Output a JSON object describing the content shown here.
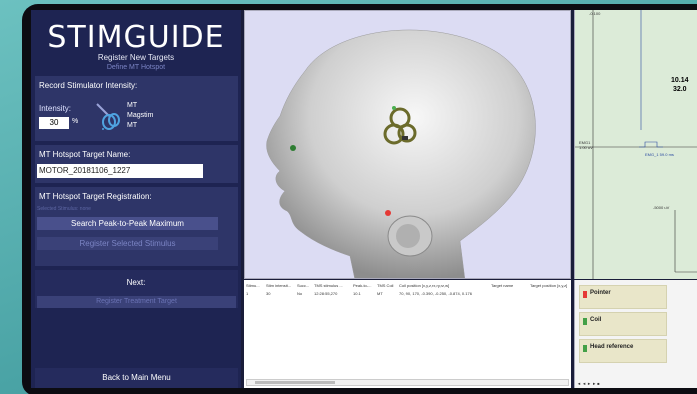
{
  "app": {
    "logo_text": "STIMGUIDE",
    "subtitle": "Register New Targets",
    "step": "Define MT Hotspot"
  },
  "intensity_section": {
    "title": "Record Stimulator Intensity:",
    "label": "Intensity:",
    "value": "30",
    "unit": "%",
    "options": [
      "MT",
      "Magstim",
      "MT"
    ]
  },
  "target_name_section": {
    "title": "MT Hotspot Target Name:",
    "value": "MOTOR_20181106_1227"
  },
  "registration_section": {
    "title": "MT Hotspot Target Registration:",
    "hint": "Selected Stimulus: none",
    "search_button": "Search Peak-to-Peak Maximum",
    "register_button": "Register Selected Stimulus"
  },
  "next_section": {
    "title": "Next:",
    "button": "Register Treatment Target"
  },
  "footer": {
    "back_button": "Back to Main Menu"
  },
  "table": {
    "headers": [
      "Stimu...",
      "Stim intensit...",
      "Succ...",
      "TMS stimulus ...",
      "Peak-to-...",
      "TMS Coil",
      "Coil position [x,y,z,rx,ry,rz,w]",
      "Target name",
      "Target position [x,y,z]"
    ],
    "rows": [
      [
        "1",
        "30",
        "No",
        "12:28:55,270",
        "10.1",
        "MT",
        "70, 90, 170, -0.390, -0.250, -0.874, 0.176",
        "",
        ""
      ]
    ]
  },
  "emg": {
    "top_value": "-0.100",
    "channel": "EMG1",
    "channel_sub": "1.00 uV",
    "trace_label": "EMG_1 59.0 ms",
    "scale_label": "-5000 uV",
    "peak_value": "10.14",
    "peak_unit": "32.0"
  },
  "status": {
    "items": [
      {
        "label": "Pointer",
        "color": "#e53935"
      },
      {
        "label": "Coil",
        "color": "#43a047"
      },
      {
        "label": "Head reference",
        "color": "#43a047"
      }
    ]
  },
  "colors": {
    "panel_bg": "#1e2452",
    "section_bg": "#2e3568",
    "view_bg": "#dcdcf3",
    "emg_bg": "#dcebd8"
  }
}
